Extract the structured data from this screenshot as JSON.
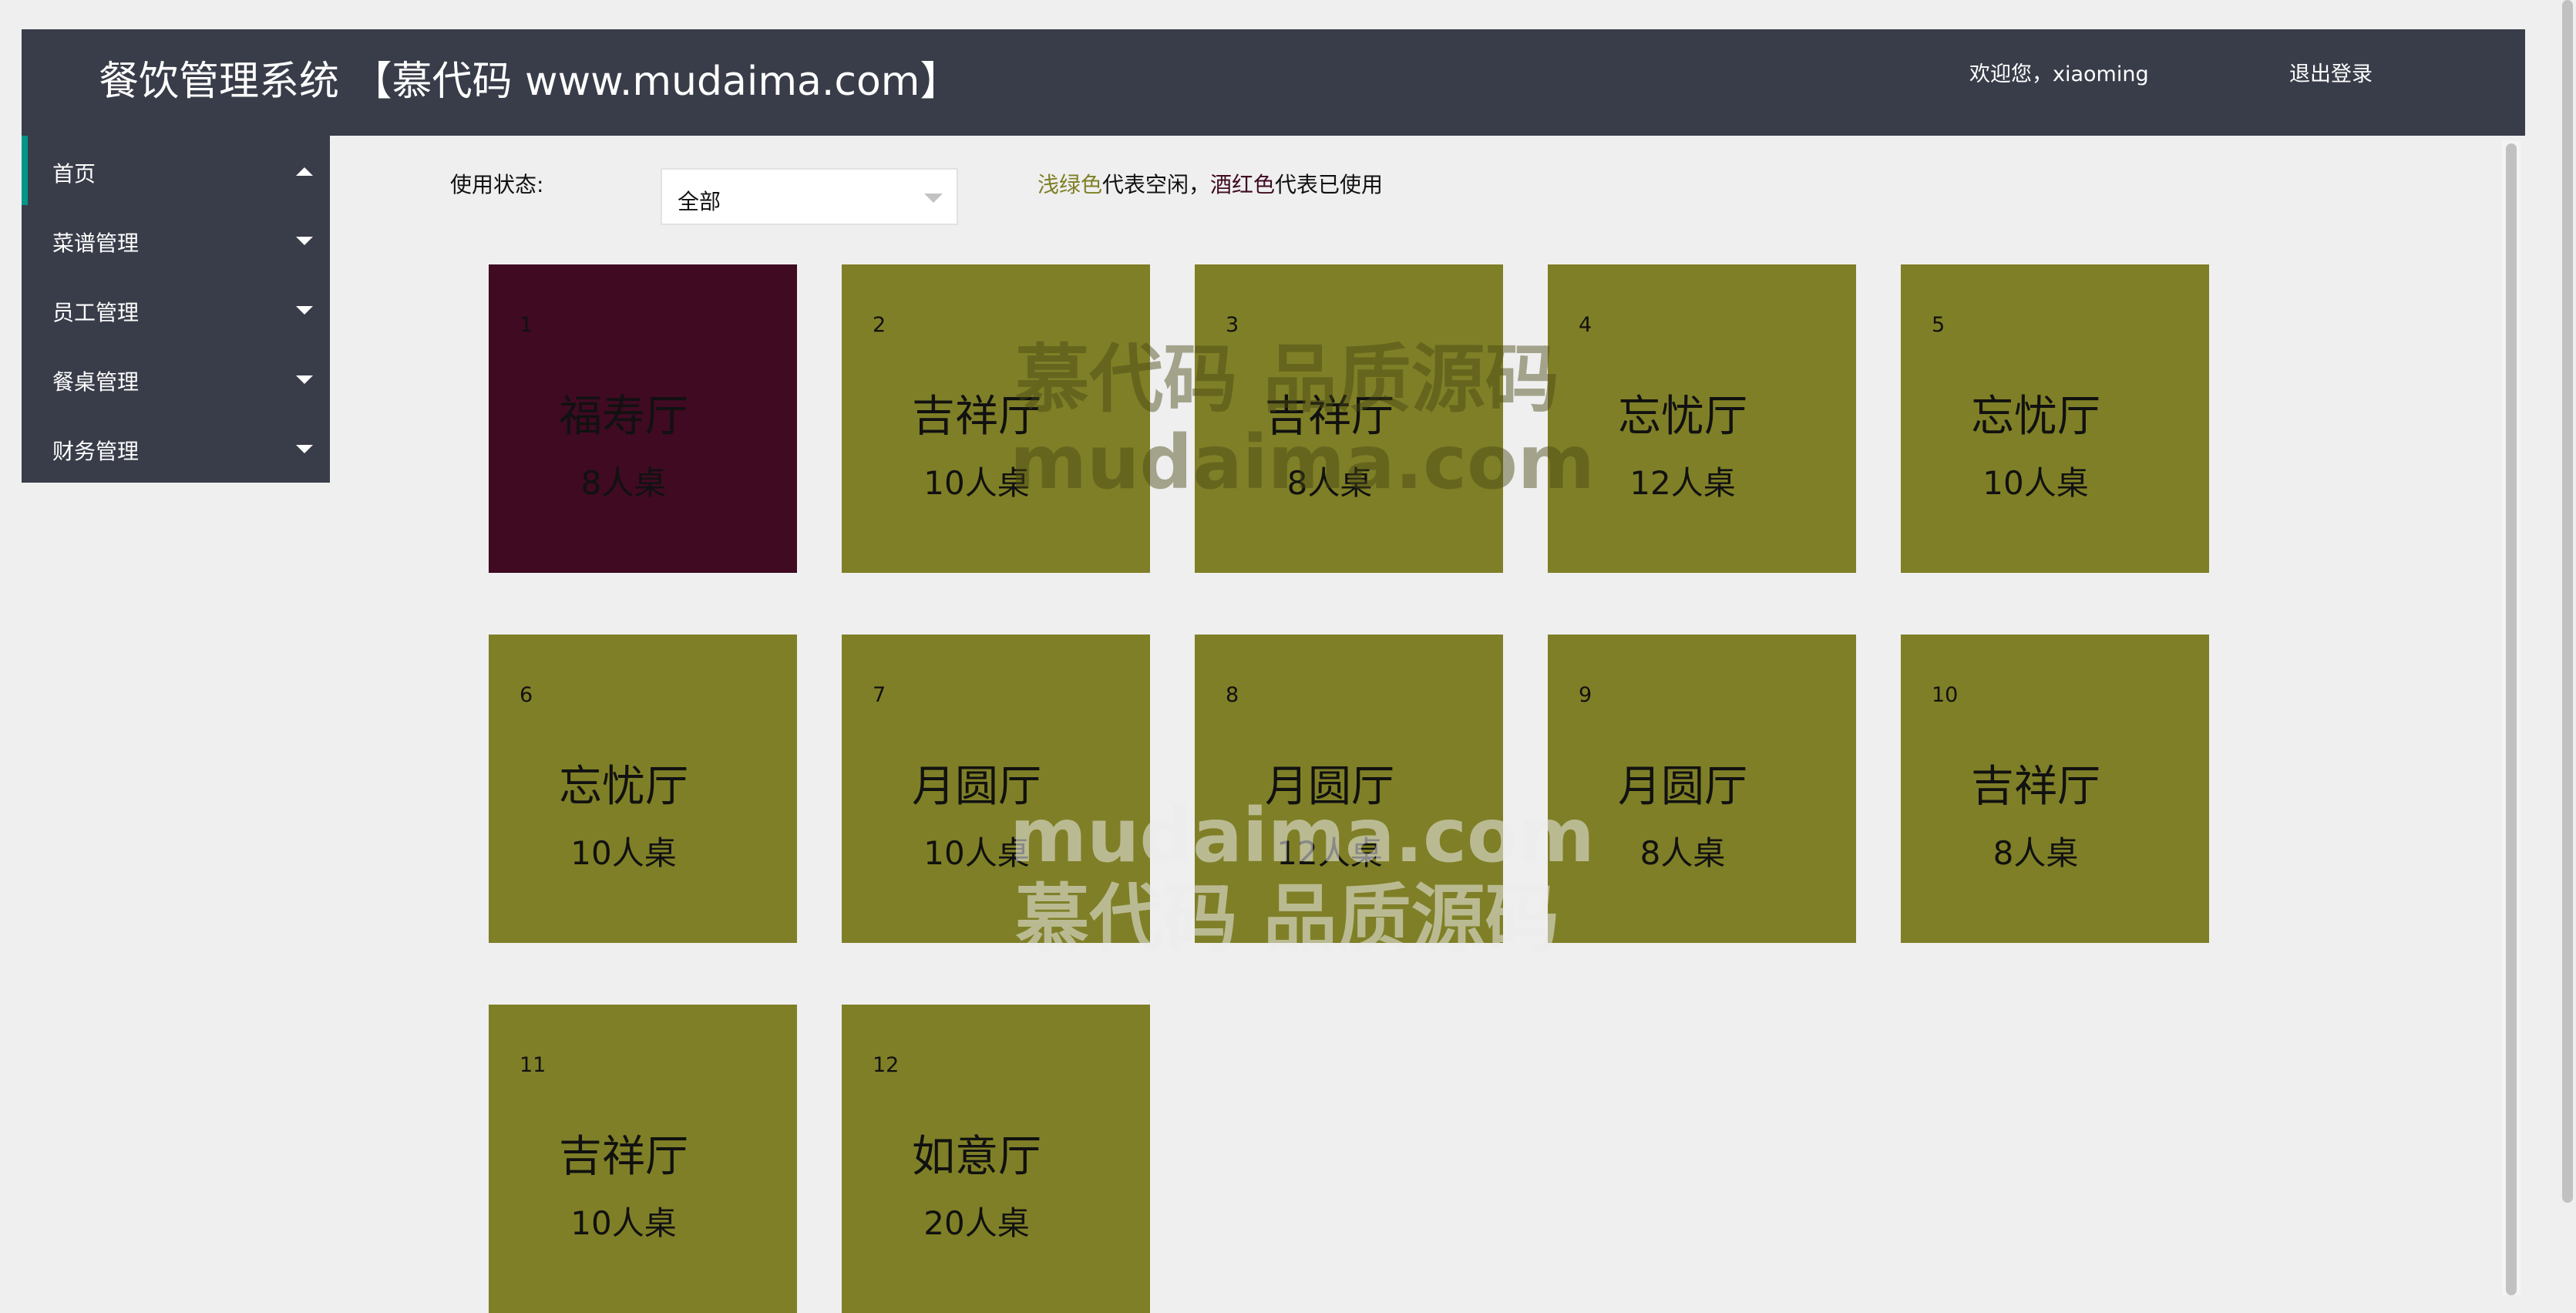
{
  "header": {
    "title": "餐饮管理系统 【慕代码 www.mudaima.com】",
    "welcome": "欢迎您，xiaoming",
    "logout": "退出登录",
    "background": "#393d49"
  },
  "sidebar": {
    "items": [
      {
        "label": "首页",
        "expanded": true,
        "active": true
      },
      {
        "label": "菜谱管理",
        "expanded": false
      },
      {
        "label": "员工管理",
        "expanded": false
      },
      {
        "label": "餐桌管理",
        "expanded": false
      },
      {
        "label": "财务管理",
        "expanded": false
      }
    ]
  },
  "filter": {
    "label": "使用状态:",
    "selected": "全部"
  },
  "legend": {
    "green_text": "浅绿色",
    "green_desc": "代表空闲，",
    "red_text": "酒红色",
    "red_desc": "代表已使用"
  },
  "colors": {
    "free": "#7f7f27",
    "used": "#3f0a22",
    "accent": "#009688"
  },
  "tables": [
    {
      "id": "1",
      "name": "福寿厅",
      "size": "8人桌",
      "status": "used"
    },
    {
      "id": "2",
      "name": "吉祥厅",
      "size": "10人桌",
      "status": "free"
    },
    {
      "id": "3",
      "name": "吉祥厅",
      "size": "8人桌",
      "status": "free"
    },
    {
      "id": "4",
      "name": "忘忧厅",
      "size": "12人桌",
      "status": "free"
    },
    {
      "id": "5",
      "name": "忘忧厅",
      "size": "10人桌",
      "status": "free"
    },
    {
      "id": "6",
      "name": "忘忧厅",
      "size": "10人桌",
      "status": "free"
    },
    {
      "id": "7",
      "name": "月圆厅",
      "size": "10人桌",
      "status": "free"
    },
    {
      "id": "8",
      "name": "月圆厅",
      "size": "12人桌",
      "status": "free"
    },
    {
      "id": "9",
      "name": "月圆厅",
      "size": "8人桌",
      "status": "free"
    },
    {
      "id": "10",
      "name": "吉祥厅",
      "size": "8人桌",
      "status": "free"
    },
    {
      "id": "11",
      "name": "吉祥厅",
      "size": "10人桌",
      "status": "free"
    },
    {
      "id": "12",
      "name": "如意厅",
      "size": "20人桌",
      "status": "free"
    }
  ],
  "watermark": {
    "line1": "慕代码 品质源码",
    "line2": "mudaima.com"
  }
}
